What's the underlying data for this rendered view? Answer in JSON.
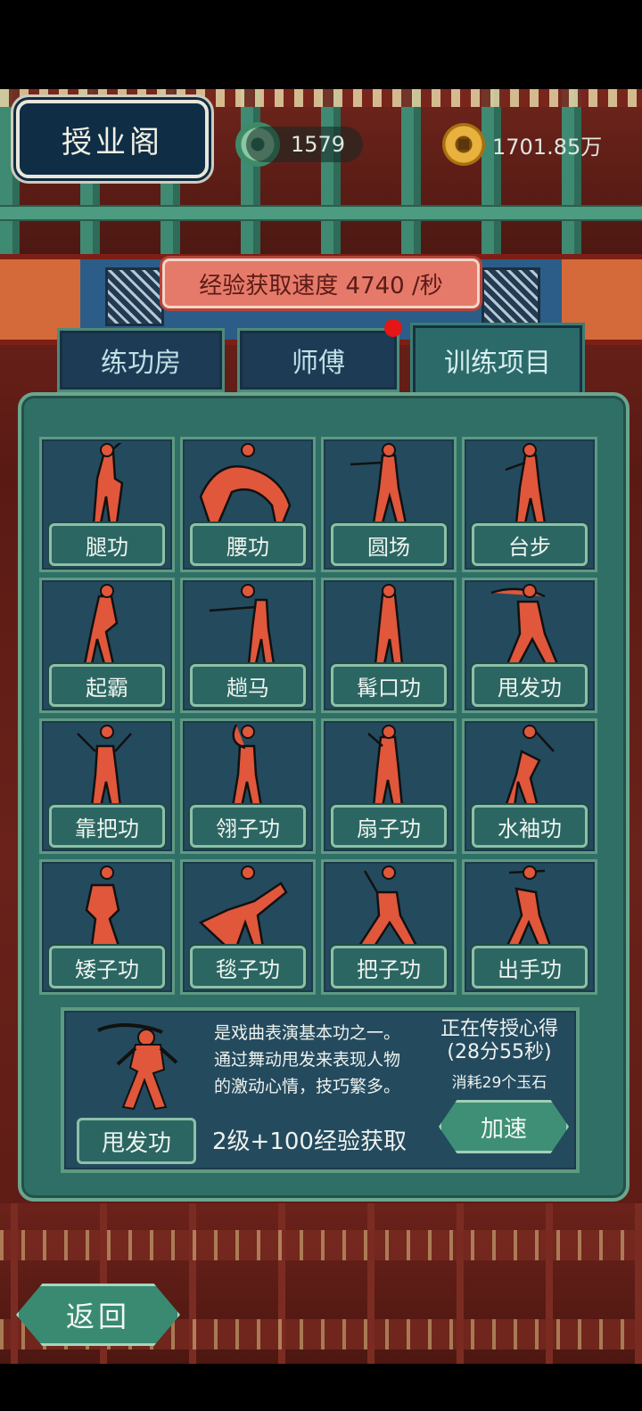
{
  "header": {
    "title": "授业阁",
    "jade_count": "1579",
    "coin_count": "1701.85万"
  },
  "exp_rate": "经验获取速度 4740 /秒",
  "tabs": [
    {
      "label": "练功房",
      "active": false
    },
    {
      "label": "师傅",
      "active": false,
      "badge": true
    },
    {
      "label": "训练项目",
      "active": true
    }
  ],
  "skills": [
    {
      "label": "腿功",
      "icon": "leg-kick-figure-icon"
    },
    {
      "label": "腰功",
      "icon": "back-bend-figure-icon"
    },
    {
      "label": "圆场",
      "icon": "circle-walk-figure-icon"
    },
    {
      "label": "台步",
      "icon": "stage-step-figure-icon"
    },
    {
      "label": "起霸",
      "icon": "qiba-figure-icon"
    },
    {
      "label": "趟马",
      "icon": "horse-whip-figure-icon"
    },
    {
      "label": "髯口功",
      "icon": "beard-figure-icon"
    },
    {
      "label": "甩发功",
      "icon": "hair-swing-figure-icon"
    },
    {
      "label": "靠把功",
      "icon": "flag-armor-figure-icon"
    },
    {
      "label": "翎子功",
      "icon": "pheasant-feather-figure-icon"
    },
    {
      "label": "扇子功",
      "icon": "fan-figure-icon"
    },
    {
      "label": "水袖功",
      "icon": "water-sleeve-figure-icon"
    },
    {
      "label": "矮子功",
      "icon": "squat-figure-icon"
    },
    {
      "label": "毯子功",
      "icon": "tumbling-figure-icon"
    },
    {
      "label": "把子功",
      "icon": "weapon-stance-figure-icon"
    },
    {
      "label": "出手功",
      "icon": "spear-throw-figure-icon"
    }
  ],
  "detail": {
    "name": "甩发功",
    "desc_lines": [
      "是戏曲表演基本功之一。",
      "通过舞动甩发来表现人物",
      "的激动心情，技巧繁多。"
    ],
    "level": "2级+100经验获取",
    "status_line1": "正在传授心得",
    "status_line2": "(28分55秒)",
    "cost": "消耗29个玉石",
    "speed_button": "加速"
  },
  "back_button": "返回",
  "colors": {
    "figure": "#e0573b",
    "panel": "#2f6f66",
    "cell": "#244a5e",
    "red_dot": "#e51616"
  }
}
